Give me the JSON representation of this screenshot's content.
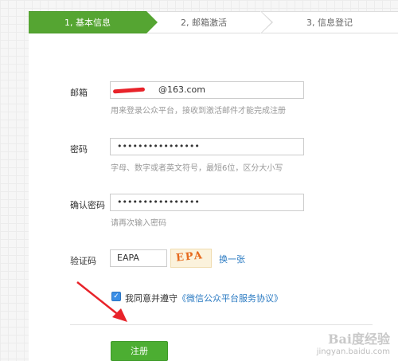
{
  "steps": [
    {
      "label": "1, 基本信息"
    },
    {
      "label": "2, 邮箱激活"
    },
    {
      "label": "3, 信息登记"
    }
  ],
  "form": {
    "email": {
      "label": "邮箱",
      "value": "@163.com",
      "hint": "用来登录公众平台，接收到激活邮件才能完成注册"
    },
    "password": {
      "label": "密码",
      "value": "••••••••••••••••",
      "hint": "字母、数字或者英文符号，最短6位，区分大小写"
    },
    "confirm": {
      "label": "确认密码",
      "value": "••••••••••••••••",
      "hint": "请再次输入密码"
    },
    "captcha": {
      "label": "验证码",
      "value": "EAPA",
      "image_text": "EPA",
      "refresh": "换一张"
    },
    "agree": {
      "text": "我同意并遵守",
      "link": "《微信公众平台服务协议》",
      "checked": true
    },
    "submit": "注册"
  },
  "watermark": {
    "logo": "Bai度经验",
    "url": "jingyan.baidu.com"
  },
  "colors": {
    "accent": "#55a532",
    "link": "#2a7ac2",
    "arrow": "#e8232a"
  }
}
